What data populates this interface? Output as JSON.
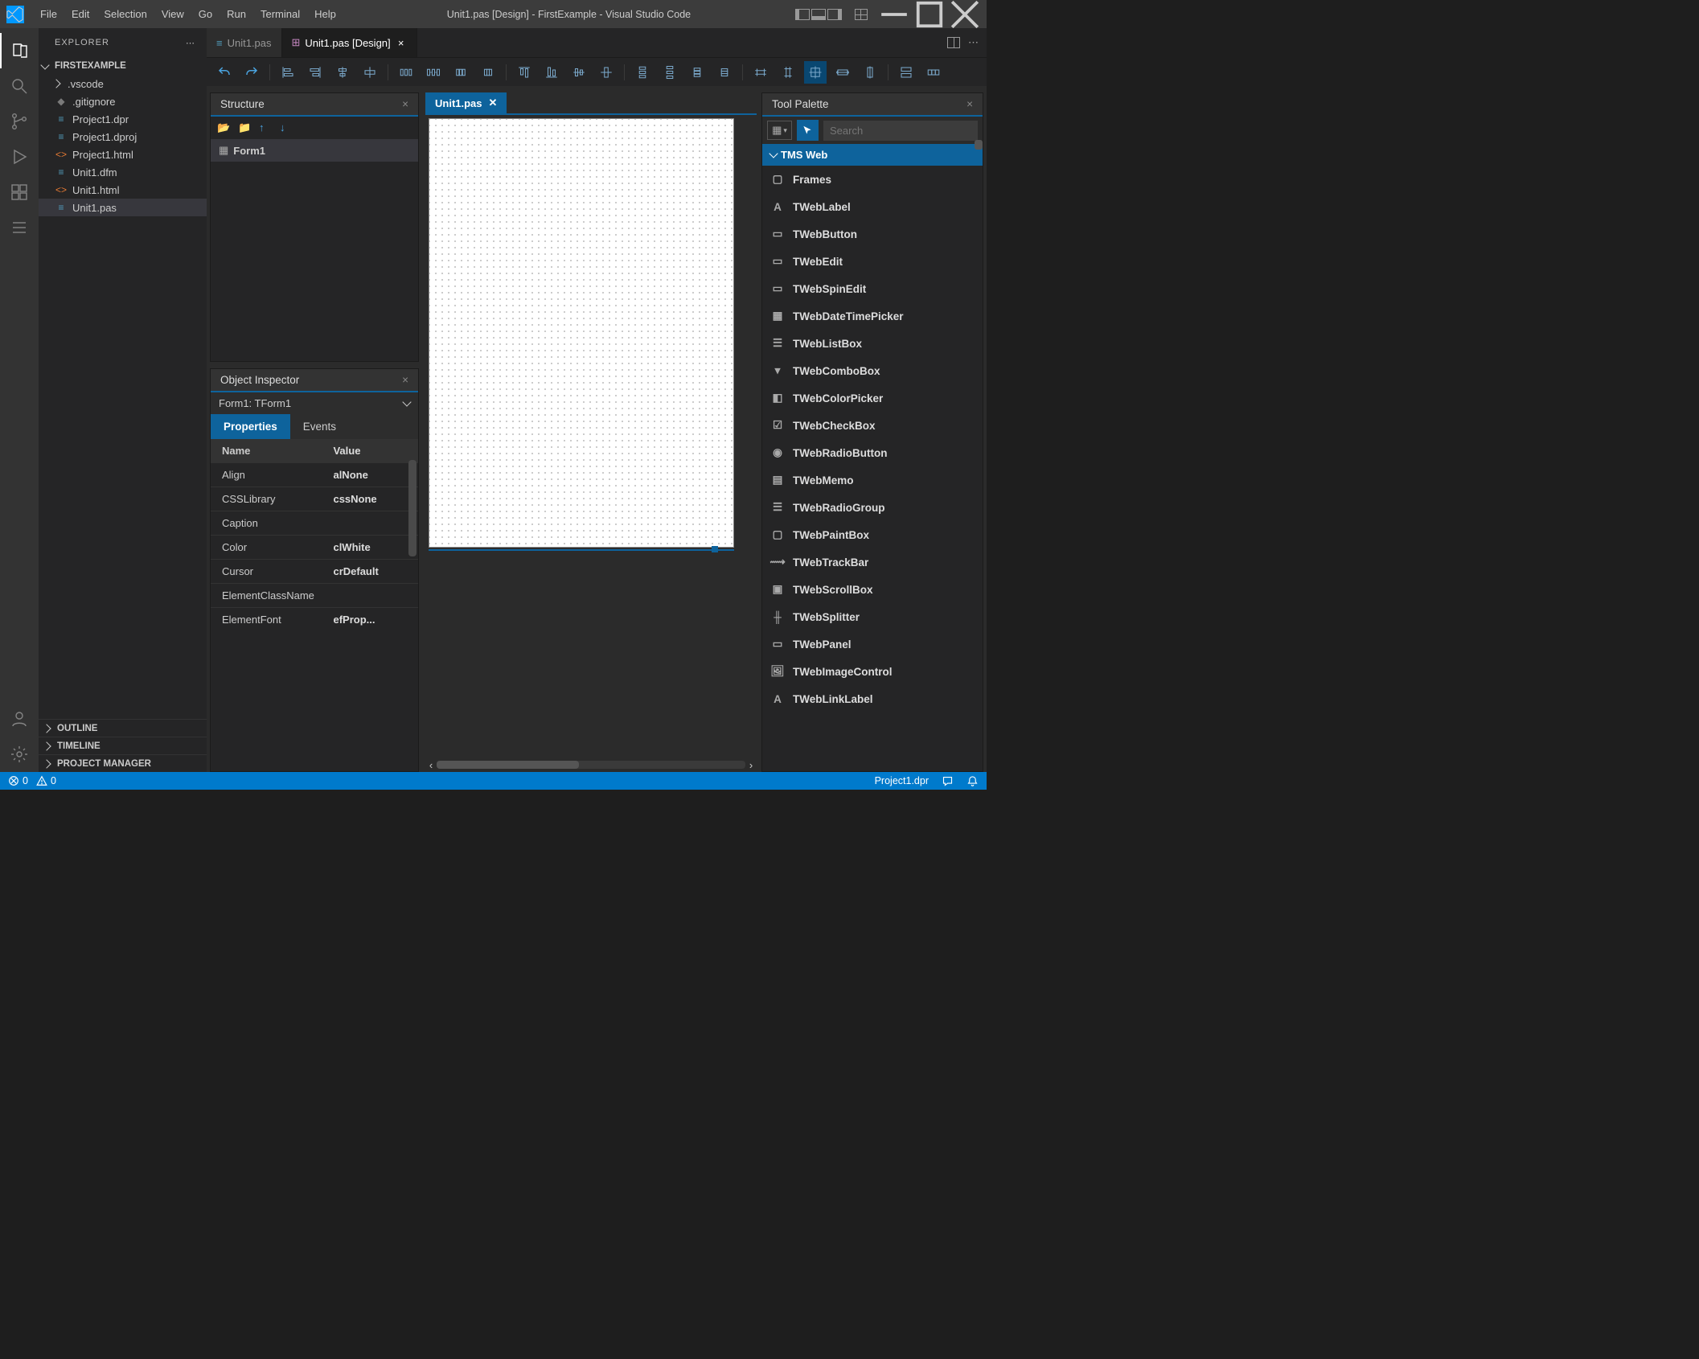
{
  "titlebar": {
    "menu": [
      "File",
      "Edit",
      "Selection",
      "View",
      "Go",
      "Run",
      "Terminal",
      "Help"
    ],
    "title": "Unit1.pas [Design] - FirstExample - Visual Studio Code"
  },
  "sidebar": {
    "title": "EXPLORER",
    "project": "FIRSTEXAMPLE",
    "files": [
      {
        "icon": "chev",
        "label": ".vscode",
        "kind": "folder"
      },
      {
        "icon": "git",
        "label": ".gitignore",
        "kind": "ignore"
      },
      {
        "icon": "gen",
        "label": "Project1.dpr",
        "kind": "pas"
      },
      {
        "icon": "gen",
        "label": "Project1.dproj",
        "kind": "pas"
      },
      {
        "icon": "html",
        "label": "Project1.html",
        "kind": "html"
      },
      {
        "icon": "gen",
        "label": "Unit1.dfm",
        "kind": "pas"
      },
      {
        "icon": "html",
        "label": "Unit1.html",
        "kind": "html"
      },
      {
        "icon": "gen",
        "label": "Unit1.pas",
        "kind": "pas",
        "selected": true
      }
    ],
    "bottom": [
      "OUTLINE",
      "TIMELINE",
      "PROJECT MANAGER"
    ]
  },
  "tabs": [
    {
      "label": "Unit1.pas",
      "icon": "pas",
      "active": false
    },
    {
      "label": "Unit1.pas [Design]",
      "icon": "design",
      "active": true
    }
  ],
  "structure": {
    "title": "Structure",
    "item": "Form1"
  },
  "inspector": {
    "title": "Object Inspector",
    "object": "Form1: TForm1",
    "tabs": [
      "Properties",
      "Events"
    ],
    "header_name": "Name",
    "header_value": "Value",
    "rows": [
      {
        "name": "Align",
        "value": "alNone"
      },
      {
        "name": "CSSLibrary",
        "value": "cssNone"
      },
      {
        "name": "Caption",
        "value": ""
      },
      {
        "name": "Color",
        "value": "clWhite"
      },
      {
        "name": "Cursor",
        "value": "crDefault"
      },
      {
        "name": "ElementClassName",
        "value": ""
      },
      {
        "name": "ElementFont",
        "value": "efProp..."
      }
    ]
  },
  "designer": {
    "tab": "Unit1.pas"
  },
  "palette": {
    "title": "Tool Palette",
    "search_placeholder": "Search",
    "category": "TMS Web",
    "items": [
      "Frames",
      "TWebLabel",
      "TWebButton",
      "TWebEdit",
      "TWebSpinEdit",
      "TWebDateTimePicker",
      "TWebListBox",
      "TWebComboBox",
      "TWebColorPicker",
      "TWebCheckBox",
      "TWebRadioButton",
      "TWebMemo",
      "TWebRadioGroup",
      "TWebPaintBox",
      "TWebTrackBar",
      "TWebScrollBox",
      "TWebSplitter",
      "TWebPanel",
      "TWebImageControl",
      "TWebLinkLabel"
    ]
  },
  "status": {
    "errors": "0",
    "warnings": "0",
    "project": "Project1.dpr"
  }
}
